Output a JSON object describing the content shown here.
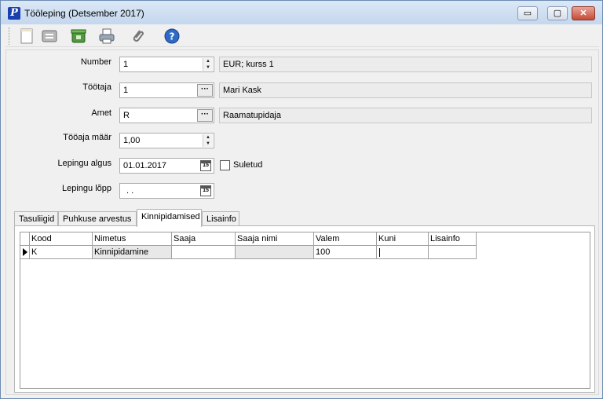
{
  "window": {
    "title": "Tööleping (Detsember 2017)",
    "app_icon_letter": "P",
    "buttons": {
      "minimize": "▭",
      "maximize": "▢",
      "close": "✕"
    }
  },
  "toolbar": {
    "items": [
      {
        "name": "new-document-icon"
      },
      {
        "name": "save-card-icon"
      },
      {
        "name": "delete-bin-icon"
      },
      {
        "name": "print-icon"
      },
      {
        "name": "attachment-icon"
      },
      {
        "name": "help-icon",
        "glyph": "?"
      }
    ]
  },
  "form": {
    "number_label": "Number",
    "number_value": "1",
    "currency_text": "EUR; kurss 1",
    "tootaja_label": "Töötaja",
    "tootaja_value": "1",
    "tootaja_name": "Mari Kask",
    "amet_label": "Amet",
    "amet_value": "R",
    "amet_name": "Raamatupidaja",
    "tooaja_maar_label": "Tööaja määr",
    "tooaja_maar_value": "1,00",
    "lepingu_algus_label": "Lepingu algus",
    "lepingu_algus_value": "01.01.2017",
    "suletud_label": "Suletud",
    "lepingu_lopp_label": "Lepingu lõpp",
    "lepingu_lopp_value": ".  .",
    "ellipsis": "···",
    "calendar_glyph": "15",
    "spin_up": "▲",
    "spin_down": "▼"
  },
  "tabs": [
    {
      "label": "Tasuliigid"
    },
    {
      "label": "Puhkuse arvestus"
    },
    {
      "label": "Kinnipidamised",
      "active": true
    },
    {
      "label": "Lisainfo"
    }
  ],
  "grid": {
    "columns": [
      "Kood",
      "Nimetus",
      "Saaja",
      "Saaja nimi",
      "Valem",
      "Kuni",
      "Lisainfo"
    ],
    "rows": [
      {
        "Kood": "K",
        "Nimetus": "Kinnipidamine",
        "Saaja": "",
        "Saaja nimi": "",
        "Valem": "100",
        "Kuni": "",
        "Lisainfo": ""
      }
    ]
  },
  "colors": {
    "window_bg": "#f0f0f0",
    "titlebar": "#c4d7ee",
    "readonly_field": "#ececec",
    "close_button": "#c44b36"
  }
}
